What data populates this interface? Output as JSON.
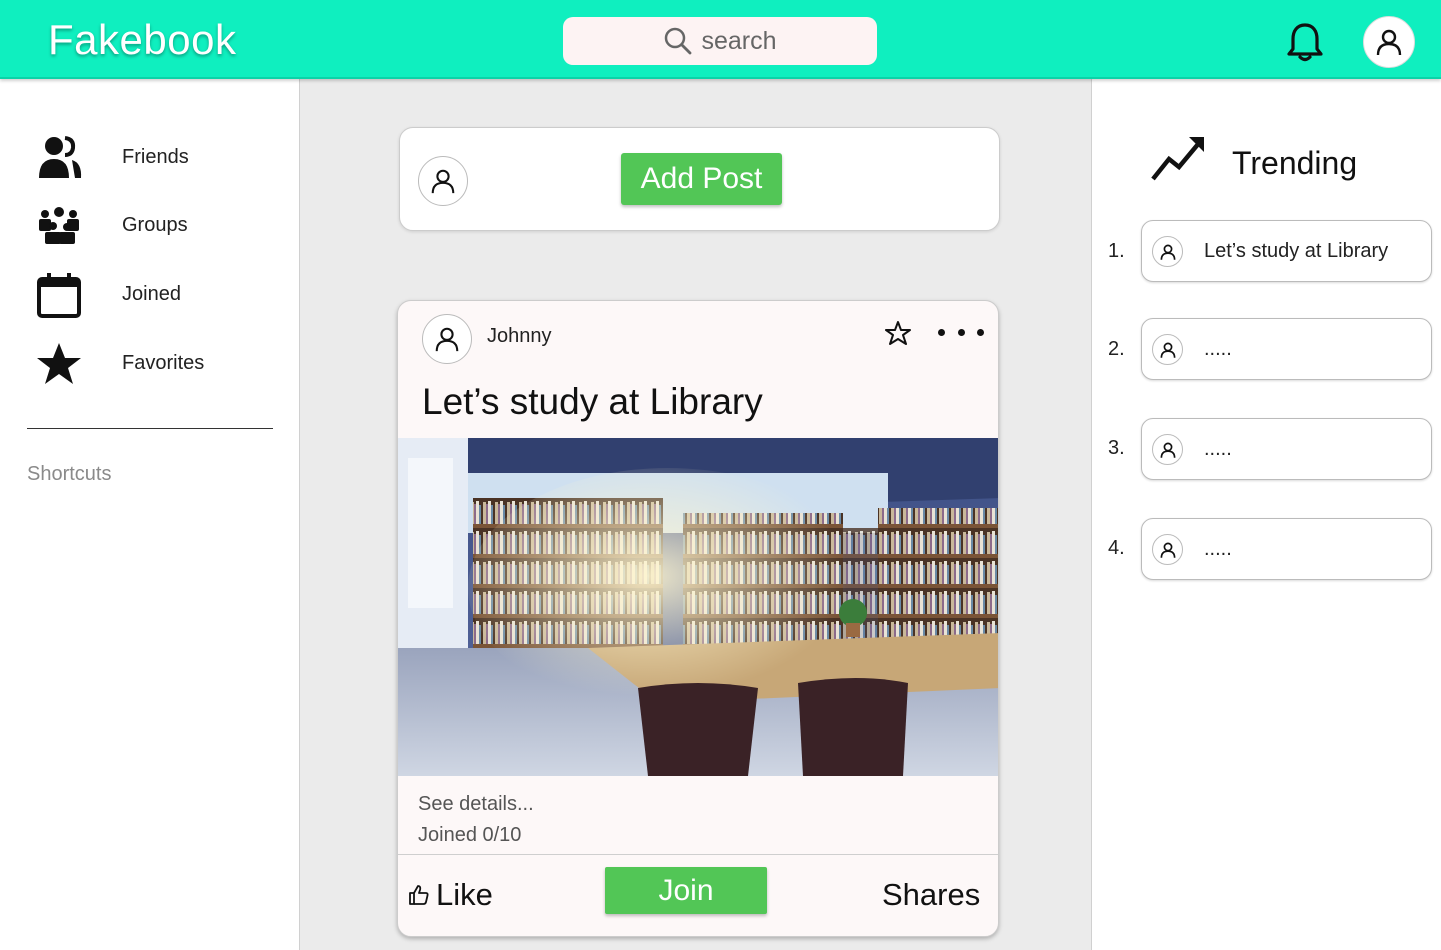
{
  "header": {
    "logo": "Fakebook",
    "search_placeholder": "search"
  },
  "sidebar": {
    "items": [
      {
        "label": "Friends",
        "icon": "friends-icon"
      },
      {
        "label": "Groups",
        "icon": "groups-icon"
      },
      {
        "label": "Joined",
        "icon": "calendar-icon"
      },
      {
        "label": "Favorites",
        "icon": "star-icon"
      }
    ],
    "shortcuts_label": "Shortcuts"
  },
  "composer": {
    "add_post_label": "Add Post"
  },
  "post": {
    "author": "Johnny",
    "title": "Let’s study at Library",
    "description": "See details...",
    "joined": "Joined 0/10",
    "like_label": "Like",
    "join_label": "Join",
    "shares_label": "Shares"
  },
  "trending": {
    "title": "Trending",
    "items": [
      {
        "number": "1.",
        "text": "Let’s study at Library"
      },
      {
        "number": "2.",
        "text": "....."
      },
      {
        "number": "3.",
        "text": "....."
      },
      {
        "number": "4.",
        "text": "....."
      }
    ]
  },
  "colors": {
    "header_bg": "#0fefbf",
    "button_green": "#52c656",
    "page_bg": "#ebebeb"
  }
}
